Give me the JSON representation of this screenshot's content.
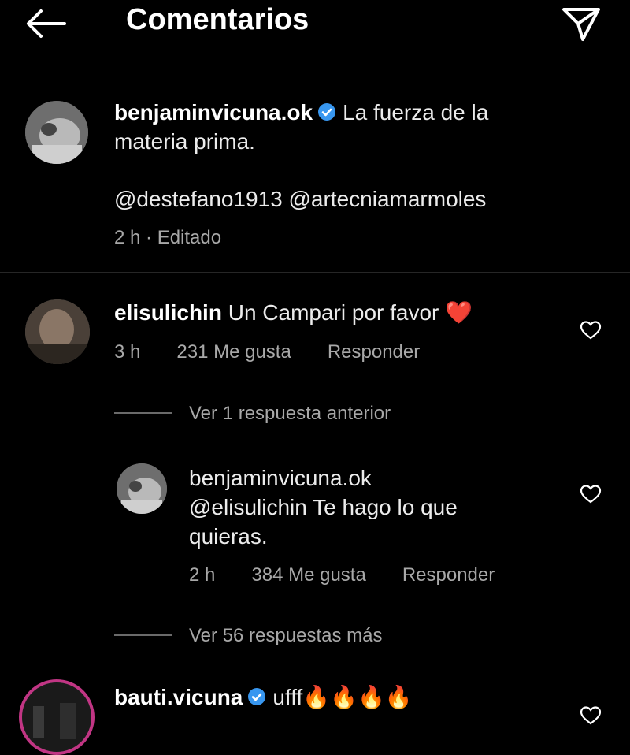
{
  "header": {
    "title": "Comentarios"
  },
  "caption": {
    "username": "benjaminvicuna.ok",
    "text_line1": "La fuerza de la",
    "text_line2": "materia prima.",
    "mentions": "@destefano1913 @artecniamarmoles",
    "meta": "2 h · Editado"
  },
  "comments": [
    {
      "username": "elisulichin",
      "text": "Un Campari por favor",
      "emoji": "❤️",
      "time": "3 h",
      "likes": "231 Me gusta",
      "reply_label": "Responder",
      "view_previous": "Ver 1 respuesta anterior",
      "replies": [
        {
          "username": "benjaminvicuna.ok",
          "text_line1": "@elisulichin Te hago lo que",
          "text_line2": "quieras.",
          "time": "2 h",
          "likes": "384 Me gusta",
          "reply_label": "Responder"
        }
      ],
      "view_more": "Ver 56 respuestas más"
    },
    {
      "username": "bauti.vicuna",
      "text": "ufff",
      "emoji": "🔥🔥🔥🔥"
    }
  ],
  "icons": {
    "back": "arrow-left-icon",
    "send": "paper-plane-icon",
    "verified": "verified-badge-icon",
    "like": "heart-outline-icon"
  },
  "colors": {
    "background": "#000000",
    "verified": "#3897f0",
    "story_ring": "#c13584",
    "heart_emoji": "#e0245e"
  }
}
